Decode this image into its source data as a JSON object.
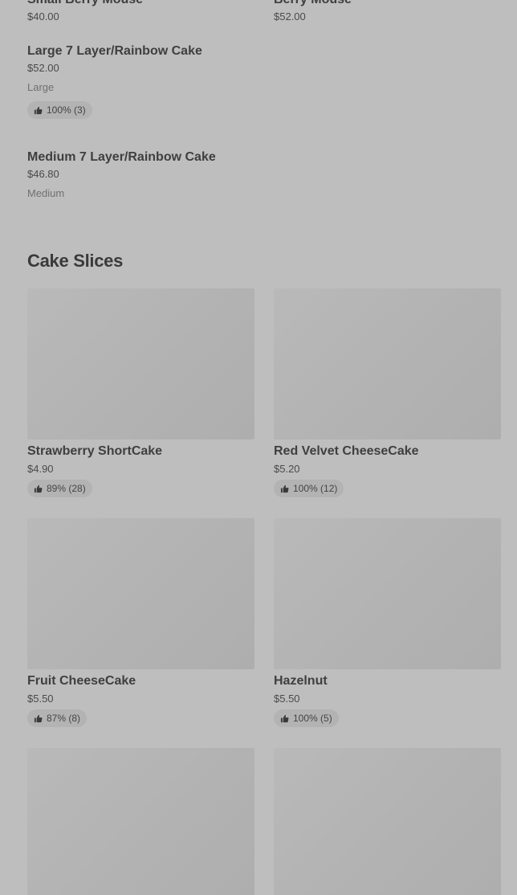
{
  "top_items": [
    {
      "name": "Small Berry Mouse",
      "price": "$40.00"
    },
    {
      "name": "Berry Mouse",
      "price": "$52.00"
    }
  ],
  "list_items": [
    {
      "name": "Large 7 Layer/Rainbow Cake",
      "price": "$52.00",
      "size": "Large",
      "rating": "100% (3)"
    },
    {
      "name": "Medium 7 Layer/Rainbow Cake",
      "price": "$46.80",
      "size": "Medium"
    }
  ],
  "section": {
    "title": "Cake Slices"
  },
  "cards": [
    {
      "name": "Strawberry ShortCake",
      "price": "$4.90",
      "rating": "89% (28)"
    },
    {
      "name": "Red Velvet CheeseCake",
      "price": "$5.20",
      "rating": "100% (12)"
    },
    {
      "name": "Fruit CheeseCake",
      "price": "$5.50",
      "rating": "87% (8)"
    },
    {
      "name": "Hazelnut",
      "price": "$5.50",
      "rating": "100% (5)"
    },
    {
      "name": "",
      "price": "",
      "rating": ""
    },
    {
      "name": "",
      "price": "",
      "rating": ""
    }
  ],
  "icons": {
    "rating": "thumbs-up-icon"
  },
  "colors": {
    "background": "#bebebe",
    "badge": "#b3b3b3",
    "text": "#404040"
  }
}
